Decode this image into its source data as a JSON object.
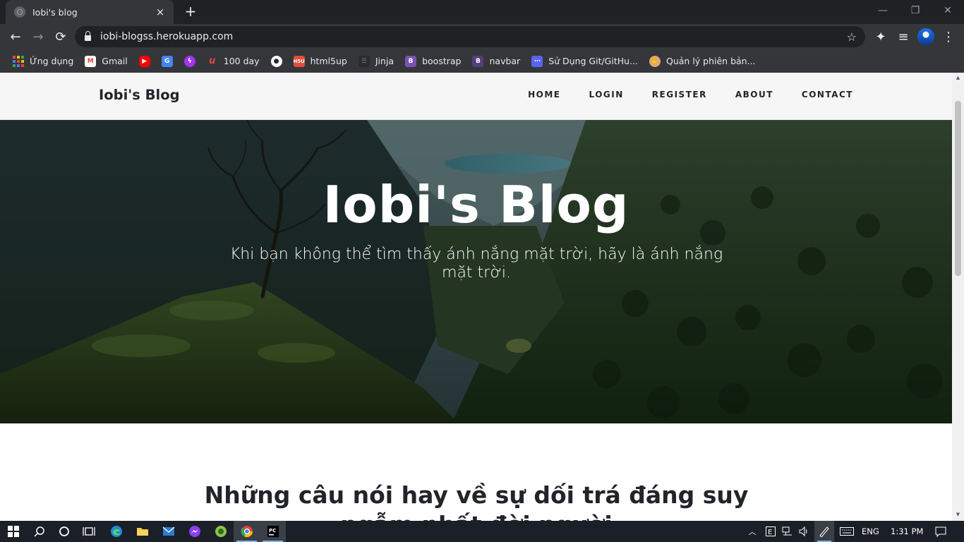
{
  "browser": {
    "tab_title": "Iobi's blog",
    "tab_close": "×",
    "new_tab": "+",
    "window_controls": {
      "minimize": "—",
      "restore": "❐",
      "close": "✕"
    },
    "url": "iobi-blogss.herokuapp.com",
    "nav_icons": {
      "back": "←",
      "forward": "→",
      "reload": "⟳",
      "star": "☆",
      "extensions": "✦",
      "media": "≡",
      "menu": "⋮"
    },
    "bookmarks": [
      {
        "label": "Ứng dụng",
        "icon": "apps-grid-icon"
      },
      {
        "label": "Gmail",
        "icon": "gmail-icon",
        "color": "#ea4335"
      },
      {
        "label": "",
        "icon": "youtube-icon",
        "color": "#ff0000"
      },
      {
        "label": "",
        "icon": "google-translate-icon",
        "color": "#4285f4"
      },
      {
        "label": "",
        "icon": "messenger-icon",
        "color": "#a334fa"
      },
      {
        "label": "100 day",
        "icon": "100day-icon",
        "color": "#e8453c"
      },
      {
        "label": "",
        "icon": "github-icon",
        "color": "#ffffff"
      },
      {
        "label": "html5up",
        "icon": "html5up-icon",
        "color": "#e44d3a"
      },
      {
        "label": "Jinja",
        "icon": "jinja-icon",
        "color": "#2b2b2b"
      },
      {
        "label": "boostrap",
        "icon": "bootstrap-icon",
        "color": "#7952b3"
      },
      {
        "label": "navbar",
        "icon": "bootstrap-icon",
        "color": "#563d7c"
      },
      {
        "label": "Sử Dụng Git/GitHu...",
        "icon": "git-icon",
        "color": "#5865f2"
      },
      {
        "label": "Quản lý phiên bản...",
        "icon": "hand-icon",
        "color": "#e0a96d"
      }
    ]
  },
  "site": {
    "brand": "Iobi's Blog",
    "nav": [
      "HOME",
      "LOGIN",
      "REGISTER",
      "ABOUT",
      "CONTACT"
    ],
    "hero_title": "Iobi's Blog",
    "hero_subtitle": "Khi bạn không thể tìm thấy ánh nắng mặt trời, hãy là ánh nắng mặt trời.",
    "post_title": "Những câu nói hay về sự dối trá đáng suy ngẫm nhất đời người"
  },
  "taskbar": {
    "language": "ENG",
    "time": "1:31 PM"
  }
}
